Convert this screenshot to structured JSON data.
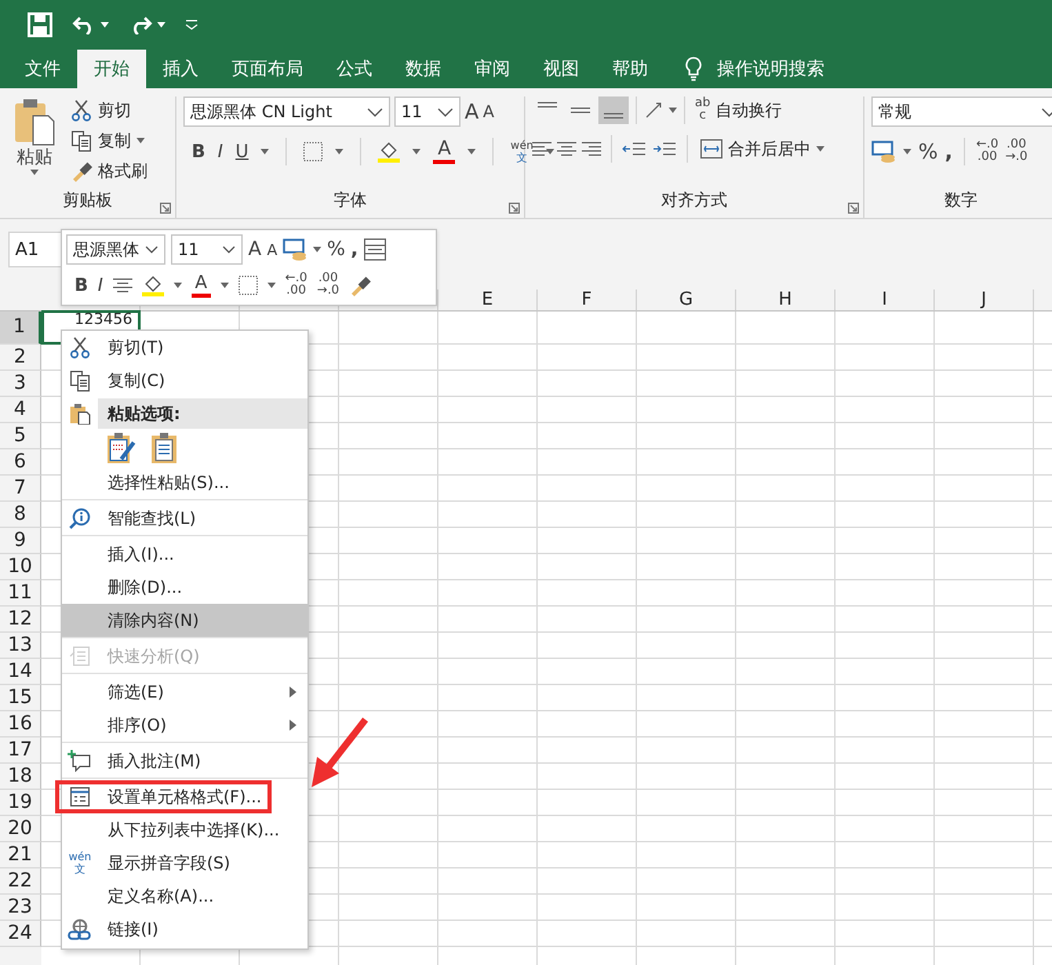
{
  "tabs": [
    {
      "label": "文件",
      "selected": false
    },
    {
      "label": "开始",
      "selected": true
    },
    {
      "label": "插入",
      "selected": false
    },
    {
      "label": "页面布局",
      "selected": false
    },
    {
      "label": "公式",
      "selected": false
    },
    {
      "label": "数据",
      "selected": false
    },
    {
      "label": "审阅",
      "selected": false
    },
    {
      "label": "视图",
      "selected": false
    },
    {
      "label": "帮助",
      "selected": false
    }
  ],
  "tell_me": "操作说明搜索",
  "ribbon": {
    "clipboard": {
      "paste": "粘贴",
      "cut": "剪切",
      "copy": "复制",
      "format_painter": "格式刷",
      "group": "剪贴板"
    },
    "font": {
      "name": "思源黑体 CN Light",
      "size": "11",
      "grow": "A",
      "shrink": "A",
      "bold": "B",
      "italic": "I",
      "underline": "U",
      "font_color": "A",
      "phonetic_top": "wén",
      "phonetic_bottom": "文",
      "group": "字体"
    },
    "alignment": {
      "vertical_align": [
        {
          "selected": false
        },
        {
          "selected": false
        },
        {
          "selected": true
        }
      ],
      "wrap_glyph_top": "ab",
      "wrap_glyph_bottom": "c",
      "wrap": "自动换行",
      "merge": "合并后居中",
      "group": "对齐方式"
    },
    "number": {
      "format": "常规",
      "percent": "%",
      "comma": ",",
      "increase_decimal": [
        "←.0",
        ".00"
      ],
      "decrease_decimal": [
        ".00",
        "→.0"
      ],
      "group": "数字"
    }
  },
  "name_box": "A1",
  "mini_toolbar": {
    "font": "思源黑体",
    "size": "11",
    "grow": "A",
    "shrink": "A",
    "percent": "%",
    "comma": ",",
    "bold": "B",
    "italic": "I",
    "font_color": "A",
    "increase_decimal": [
      "←.0",
      ".00"
    ],
    "decrease_decimal": [
      ".00",
      "→.0"
    ]
  },
  "columns": [
    "E",
    "F",
    "G",
    "H",
    "I",
    "J"
  ],
  "rows": [
    "1",
    "2",
    "3",
    "4",
    "5",
    "6",
    "7",
    "8",
    "9",
    "10",
    "11",
    "12",
    "13",
    "14",
    "15",
    "16",
    "17",
    "18",
    "19",
    "20",
    "21",
    "22",
    "23",
    "24"
  ],
  "cell_a1": "123456",
  "context_menu": [
    {
      "kind": "item",
      "label": "剪切(T)",
      "highlighted": false,
      "disabled": false,
      "submenu": false,
      "separator_after": false
    },
    {
      "kind": "item",
      "label": "复制(C)",
      "highlighted": false,
      "disabled": false,
      "submenu": false,
      "separator_after": false
    },
    {
      "kind": "header",
      "label": "粘贴选项:",
      "highlighted": false,
      "disabled": false,
      "submenu": false,
      "separator_after": false
    },
    {
      "kind": "paste_options",
      "highlighted": false,
      "disabled": false,
      "submenu": false,
      "separator_after": false
    },
    {
      "kind": "item",
      "label": "选择性粘贴(S)...",
      "highlighted": false,
      "disabled": false,
      "submenu": false,
      "separator_after": true
    },
    {
      "kind": "item",
      "label": "智能查找(L)",
      "highlighted": false,
      "disabled": false,
      "submenu": false,
      "separator_after": true
    },
    {
      "kind": "item",
      "label": "插入(I)...",
      "highlighted": false,
      "disabled": false,
      "submenu": false,
      "separator_after": false
    },
    {
      "kind": "item",
      "label": "删除(D)...",
      "highlighted": false,
      "disabled": false,
      "submenu": false,
      "separator_after": false
    },
    {
      "kind": "item",
      "label": "清除内容(N)",
      "highlighted": true,
      "disabled": false,
      "submenu": false,
      "separator_after": true
    },
    {
      "kind": "item",
      "label": "快速分析(Q)",
      "highlighted": false,
      "disabled": true,
      "submenu": false,
      "separator_after": true
    },
    {
      "kind": "item",
      "label": "筛选(E)",
      "highlighted": false,
      "disabled": false,
      "submenu": true,
      "separator_after": false
    },
    {
      "kind": "item",
      "label": "排序(O)",
      "highlighted": false,
      "disabled": false,
      "submenu": true,
      "separator_after": true
    },
    {
      "kind": "item",
      "label": "插入批注(M)",
      "highlighted": false,
      "disabled": false,
      "submenu": false,
      "separator_after": true
    },
    {
      "kind": "item",
      "label": "设置单元格格式(F)...",
      "callout": true,
      "highlighted": false,
      "disabled": false,
      "submenu": false,
      "separator_after": false
    },
    {
      "kind": "item",
      "label": "从下拉列表中选择(K)...",
      "highlighted": false,
      "disabled": false,
      "submenu": false,
      "separator_after": false
    },
    {
      "kind": "item",
      "label": "显示拼音字段(S)",
      "icon_top": "wén",
      "icon_bottom": "文",
      "highlighted": false,
      "disabled": false,
      "submenu": false,
      "separator_after": false
    },
    {
      "kind": "item",
      "label": "定义名称(A)...",
      "highlighted": false,
      "disabled": false,
      "submenu": false,
      "separator_after": false
    },
    {
      "kind": "item",
      "label": "链接(I)",
      "highlighted": false,
      "disabled": false,
      "submenu": false,
      "separator_after": false
    }
  ]
}
